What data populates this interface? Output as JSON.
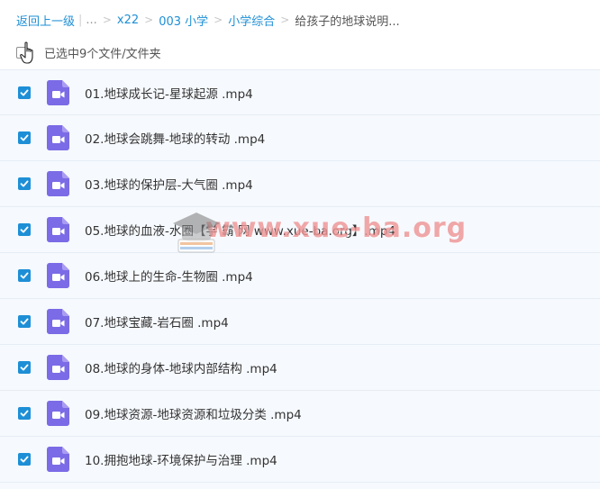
{
  "breadcrumb": {
    "back": "返回上一级",
    "ellipsis": "...",
    "items": [
      "x22",
      "003 小学",
      "小学综合"
    ],
    "current": "给孩子的地球说明..."
  },
  "selection": {
    "text": "已选中9个文件/文件夹"
  },
  "files": [
    "01.地球成长记-星球起源 .mp4",
    "02.地球会跳舞-地球的转动 .mp4",
    "03.地球的保护层-大气圈 .mp4",
    "05.地球的血液-水圈【学 霸 网 www.xue-ba.org】.mp4",
    "06.地球上的生命-生物圈 .mp4",
    "07.地球宝藏-岩石圈 .mp4",
    "08.地球的身体-地球内部结构 .mp4",
    "09.地球资源-地球资源和垃圾分类 .mp4",
    "10.拥抱地球-环境保护与治理 .mp4"
  ],
  "watermark": {
    "text": "www.xue-ba.org"
  },
  "colors": {
    "accent": "#1e8fd6",
    "video_icon": "#7b6be6",
    "row_bg": "#f6f9fd"
  },
  "icons": {
    "file": "video-file-icon",
    "check": "checkmark-icon",
    "cursor": "hand-pointer-icon",
    "logo": "graduation-cap-icon"
  }
}
